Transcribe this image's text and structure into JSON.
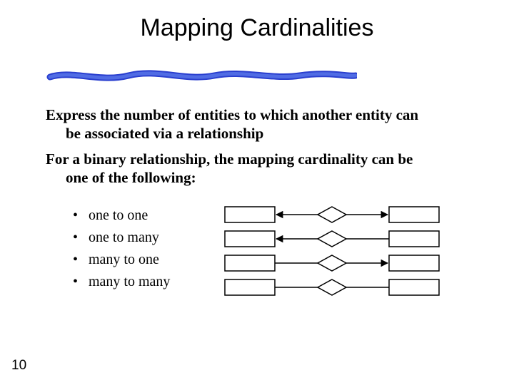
{
  "title": "Mapping Cardinalities",
  "para1_line1": "Express the number of entities to which another entity can",
  "para1_line2": "be associated via a relationship",
  "para2_line1": "For a binary relationship, the mapping cardinality can be",
  "para2_line2": "one of the following:",
  "bullets": {
    "b0": "one to one",
    "b1": "one to many",
    "b2": "many to one",
    "b3": "many to many"
  },
  "page_number": "10"
}
